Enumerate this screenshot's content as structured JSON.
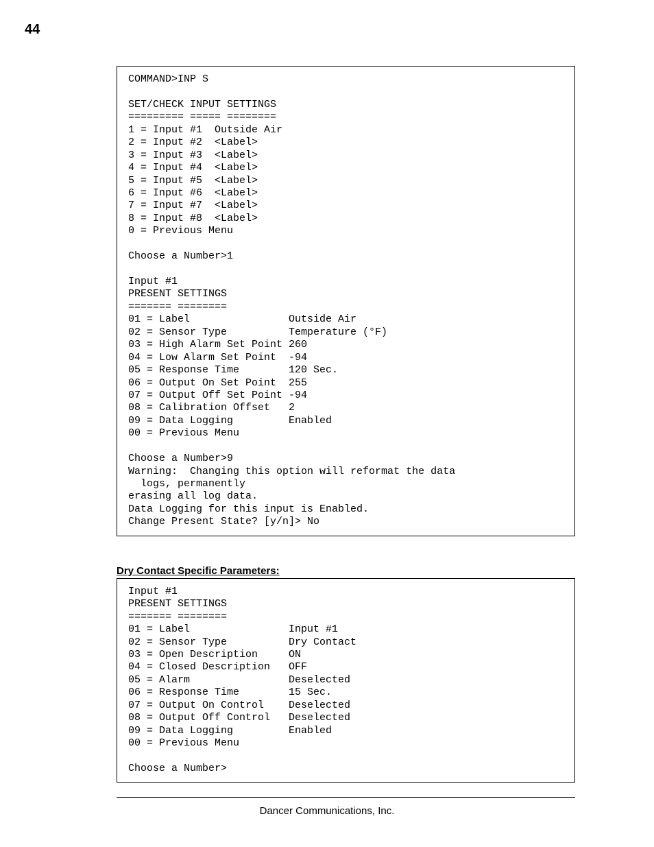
{
  "page_number": "44",
  "box1": {
    "cmd": "COMMAND>INP S",
    "title": "SET/CHECK INPUT SETTINGS",
    "title_sep": "========= ===== ========",
    "menu": [
      "1 = Input #1  Outside Air",
      "2 = Input #2  <Label>",
      "3 = Input #3  <Label>",
      "4 = Input #4  <Label>",
      "5 = Input #5  <Label>",
      "6 = Input #6  <Label>",
      "7 = Input #7  <Label>",
      "8 = Input #8  <Label>",
      "0 = Previous Menu"
    ],
    "choose": "Choose a Number>1",
    "input_header": "Input #1",
    "settings_title": "PRESENT SETTINGS",
    "settings_sep": "======= ========",
    "settings": [
      {
        "k": "01 = Label",
        "v": "Outside Air"
      },
      {
        "k": "02 = Sensor Type",
        "v": "Temperature (°F)"
      },
      {
        "k": "03 = High Alarm Set Point",
        "v": "260"
      },
      {
        "k": "04 = Low Alarm Set Point",
        "v": "-94"
      },
      {
        "k": "05 = Response Time",
        "v": "120 Sec."
      },
      {
        "k": "06 = Output On Set Point",
        "v": "255"
      },
      {
        "k": "07 = Output Off Set Point",
        "v": "-94"
      },
      {
        "k": "08 = Calibration Offset",
        "v": "2"
      },
      {
        "k": "09 = Data Logging",
        "v": "Enabled"
      },
      {
        "k": "00 = Previous Menu",
        "v": ""
      }
    ],
    "trailer": [
      "Choose a Number>9",
      "Warning:  Changing this option will reformat the data",
      "  logs, permanently",
      "erasing all log data.",
      "Data Logging for this input is Enabled.",
      "Change Present State? [y/n]> No"
    ]
  },
  "section_heading": "Dry Contact  Specific Parameters:",
  "box2": {
    "input_header": "Input #1",
    "settings_title": "PRESENT SETTINGS",
    "settings_sep": "======= ========",
    "settings": [
      {
        "k": "01 = Label",
        "v": "Input #1"
      },
      {
        "k": "02 = Sensor Type",
        "v": "Dry Contact"
      },
      {
        "k": "03 = Open Description",
        "v": "ON"
      },
      {
        "k": "04 = Closed Description",
        "v": "OFF"
      },
      {
        "k": "05 = Alarm",
        "v": "Deselected"
      },
      {
        "k": "06 = Response Time",
        "v": "15 Sec."
      },
      {
        "k": "07 = Output On Control",
        "v": "Deselected"
      },
      {
        "k": "08 = Output Off Control",
        "v": "Deselected"
      },
      {
        "k": "09 = Data Logging",
        "v": "Enabled"
      },
      {
        "k": "00 = Previous Menu",
        "v": ""
      }
    ],
    "trailer": [
      "Choose a Number>"
    ]
  },
  "footer": "Dancer Communications, Inc."
}
